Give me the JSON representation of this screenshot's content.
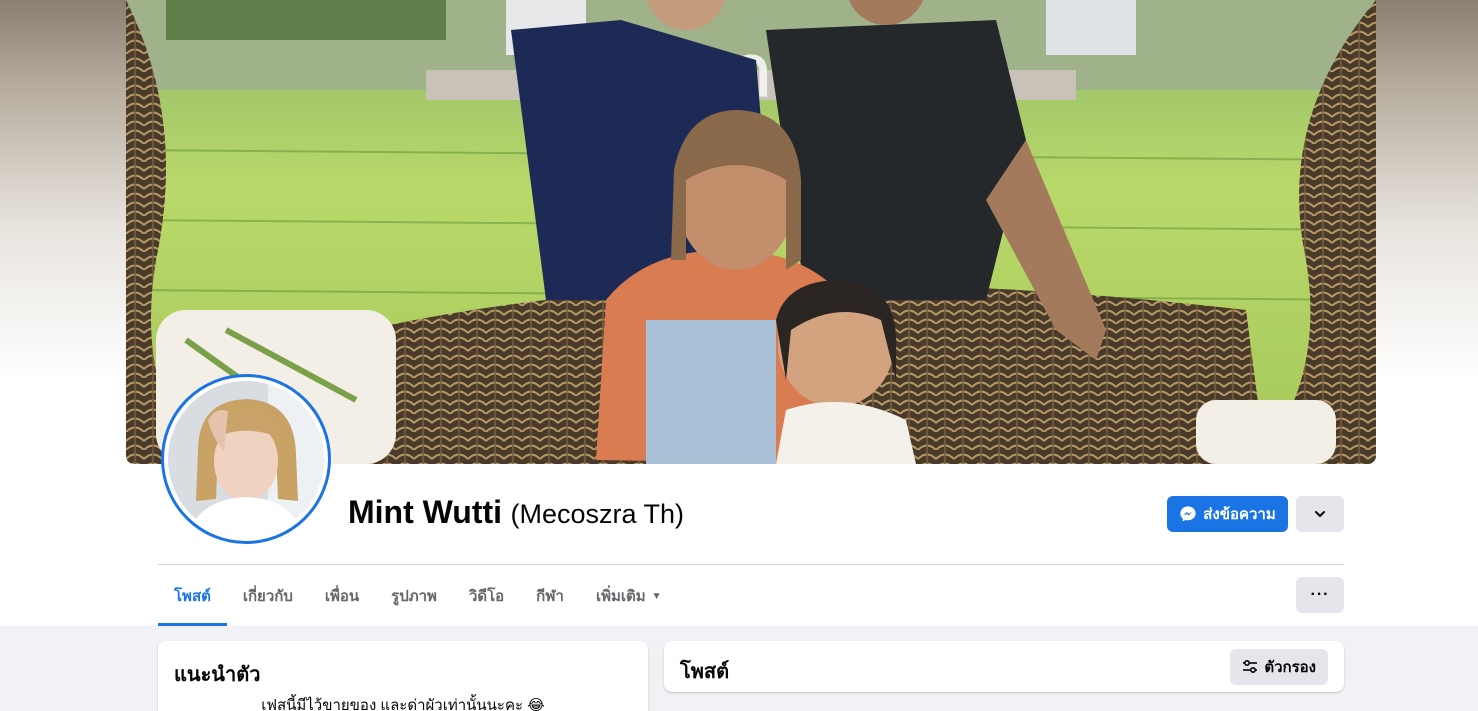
{
  "profile": {
    "name": "Mint Wutti",
    "alternate_name": "(Mecoszra Th)"
  },
  "actions": {
    "message_label": "ส่งข้อความ",
    "message_icon": "messenger-icon",
    "more_icon": "chevron-down-icon",
    "options_label": "···"
  },
  "tabs": [
    {
      "label": "โพสต์",
      "active": true
    },
    {
      "label": "เกี่ยวกับ",
      "active": false
    },
    {
      "label": "เพื่อน",
      "active": false
    },
    {
      "label": "รูปภาพ",
      "active": false
    },
    {
      "label": "วิดีโอ",
      "active": false
    },
    {
      "label": "กีฬา",
      "active": false
    },
    {
      "label": "เพิ่มเติม",
      "active": false
    }
  ],
  "intro": {
    "title": "แนะนำตัว",
    "bio": "เฟสนี้มีไว้ขายของ และด่าผัวเท่านั้นนะคะ 😂"
  },
  "posts": {
    "title": "โพสต์",
    "filter_label": "ตัวกรอง",
    "filter_icon": "sliders-icon"
  },
  "colors": {
    "accent": "#1b74e4",
    "secondary_button": "#e4e6eb",
    "page_bg": "#f0f2f5"
  }
}
